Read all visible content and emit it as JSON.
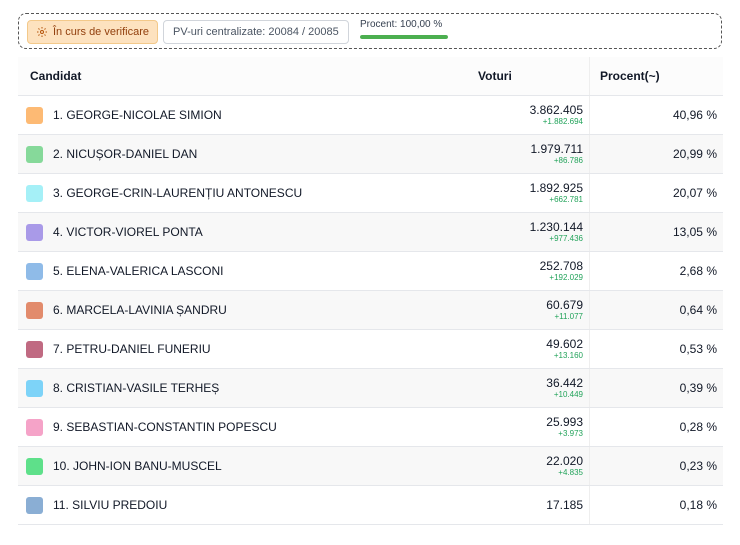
{
  "status": {
    "verify_label": "În curs de verificare",
    "pv_label": "PV-uri centralizate: 20084 / 20085",
    "progress_label": "Procent: 100,00 %",
    "progress_fraction": 1.0,
    "progress_color": "#4caf50"
  },
  "table": {
    "headers": {
      "candidate": "Candidat",
      "votes": "Voturi",
      "percent": "Procent(~)"
    },
    "rows": [
      {
        "name": "1. GEORGE-NICOLAE SIMION",
        "votes": "3.862.405",
        "delta": "+1.882.694",
        "percent": "40,96 %",
        "color": "#fdba74"
      },
      {
        "name": "2. NICUȘOR-DANIEL DAN",
        "votes": "1.979.711",
        "delta": "+86.786",
        "percent": "20,99 %",
        "color": "#86d99a"
      },
      {
        "name": "3. GEORGE-CRIN-LAURENȚIU ANTONESCU",
        "votes": "1.892.925",
        "delta": "+662.781",
        "percent": "20,07 %",
        "color": "#a5f0f7"
      },
      {
        "name": "4. VICTOR-VIOREL PONTA",
        "votes": "1.230.144",
        "delta": "+977.436",
        "percent": "13,05 %",
        "color": "#a99ae8"
      },
      {
        "name": "5. ELENA-VALERICA LASCONI",
        "votes": "252.708",
        "delta": "+192.029",
        "percent": "2,68 %",
        "color": "#8fbbe8"
      },
      {
        "name": "6. MARCELA-LAVINIA ȘANDRU",
        "votes": "60.679",
        "delta": "+11.077",
        "percent": "0,64 %",
        "color": "#e28b6c"
      },
      {
        "name": "7. PETRU-DANIEL FUNERIU",
        "votes": "49.602",
        "delta": "+13.160",
        "percent": "0,53 %",
        "color": "#c06a82"
      },
      {
        "name": "8. CRISTIAN-VASILE TERHEȘ",
        "votes": "36.442",
        "delta": "+10.449",
        "percent": "0,39 %",
        "color": "#7dd3f8"
      },
      {
        "name": "9. SEBASTIAN-CONSTANTIN POPESCU",
        "votes": "25.993",
        "delta": "+3.973",
        "percent": "0,28 %",
        "color": "#f5a3c8"
      },
      {
        "name": "10. JOHN-ION BANU-MUSCEL",
        "votes": "22.020",
        "delta": "+4.835",
        "percent": "0,23 %",
        "color": "#5ee08a"
      },
      {
        "name": "11. SILVIU PREDOIU",
        "votes": "17.185",
        "delta": "",
        "percent": "0,18 %",
        "color": "#8aaed4"
      }
    ]
  }
}
